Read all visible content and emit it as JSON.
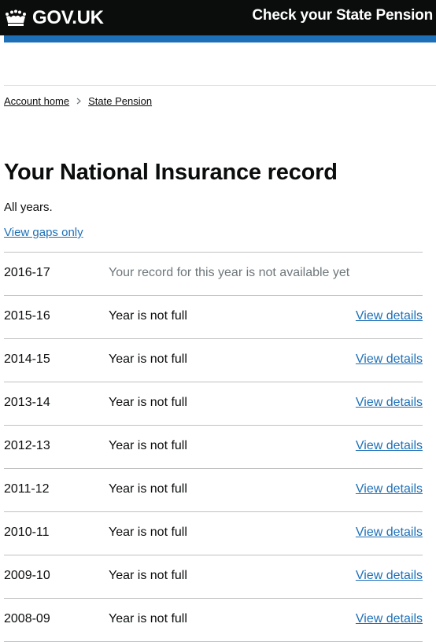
{
  "header": {
    "logo_text": "GOV.UK",
    "logo_icon": "crown-icon",
    "service_name": "Check your State Pension"
  },
  "breadcrumb": [
    {
      "label": "Account home"
    },
    {
      "label": "State Pension"
    }
  ],
  "page": {
    "title": "Your National Insurance record",
    "subtitle": "All years.",
    "view_gaps_link": "View gaps only"
  },
  "records": [
    {
      "year": "2016-17",
      "status": "Your record for this year is not available yet",
      "details": ""
    },
    {
      "year": "2015-16",
      "status": "Year is not full",
      "details": "View details"
    },
    {
      "year": "2014-15",
      "status": "Year is not full",
      "details": "View details"
    },
    {
      "year": "2013-14",
      "status": "Year is not full",
      "details": "View details"
    },
    {
      "year": "2012-13",
      "status": "Year is not full",
      "details": "View details"
    },
    {
      "year": "2011-12",
      "status": "Year is not full",
      "details": "View details"
    },
    {
      "year": "2010-11",
      "status": "Year is not full",
      "details": "View details"
    },
    {
      "year": "2009-10",
      "status": "Year is not full",
      "details": "View details"
    },
    {
      "year": "2008-09",
      "status": "Year is not full",
      "details": "View details"
    }
  ],
  "colors": {
    "header_bg": "#0b0c0c",
    "accent_blue": "#1d70b8",
    "link": "#1d70b8",
    "muted_text": "#6f777b",
    "divider": "#bfc1c3"
  }
}
